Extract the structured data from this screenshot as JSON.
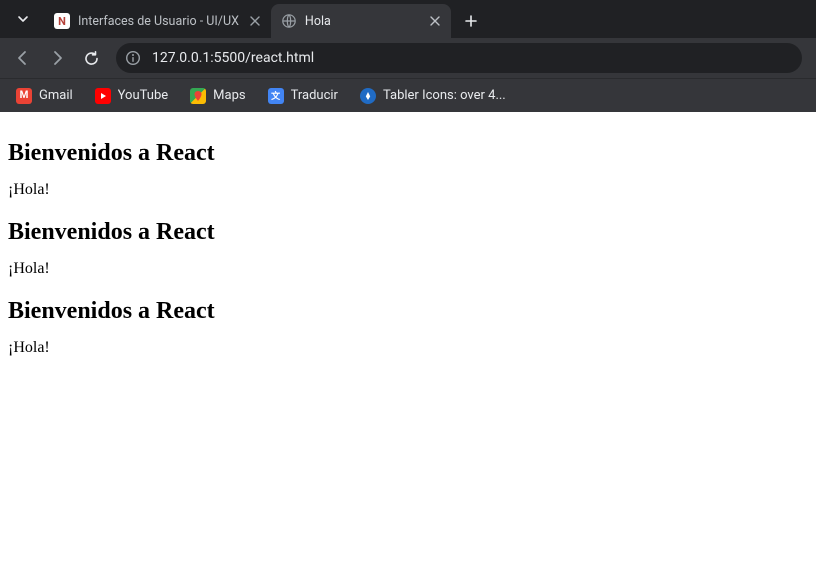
{
  "tabs": [
    {
      "title": "Interfaces de Usuario - UI/UX",
      "active": false,
      "favicon": "notion"
    },
    {
      "title": "Hola",
      "active": true,
      "favicon": "globe"
    }
  ],
  "omnibox": {
    "url": "127.0.0.1:5500/react.html"
  },
  "bookmarks": [
    {
      "label": "Gmail",
      "icon": "gmail"
    },
    {
      "label": "YouTube",
      "icon": "youtube"
    },
    {
      "label": "Maps",
      "icon": "maps"
    },
    {
      "label": "Traducir",
      "icon": "translate"
    },
    {
      "label": "Tabler Icons: over 4...",
      "icon": "tabler"
    }
  ],
  "content": {
    "sections": [
      {
        "heading": "Bienvenidos a React",
        "text": "¡Hola!"
      },
      {
        "heading": "Bienvenidos a React",
        "text": "¡Hola!"
      },
      {
        "heading": "Bienvenidos a React",
        "text": "¡Hola!"
      }
    ]
  }
}
